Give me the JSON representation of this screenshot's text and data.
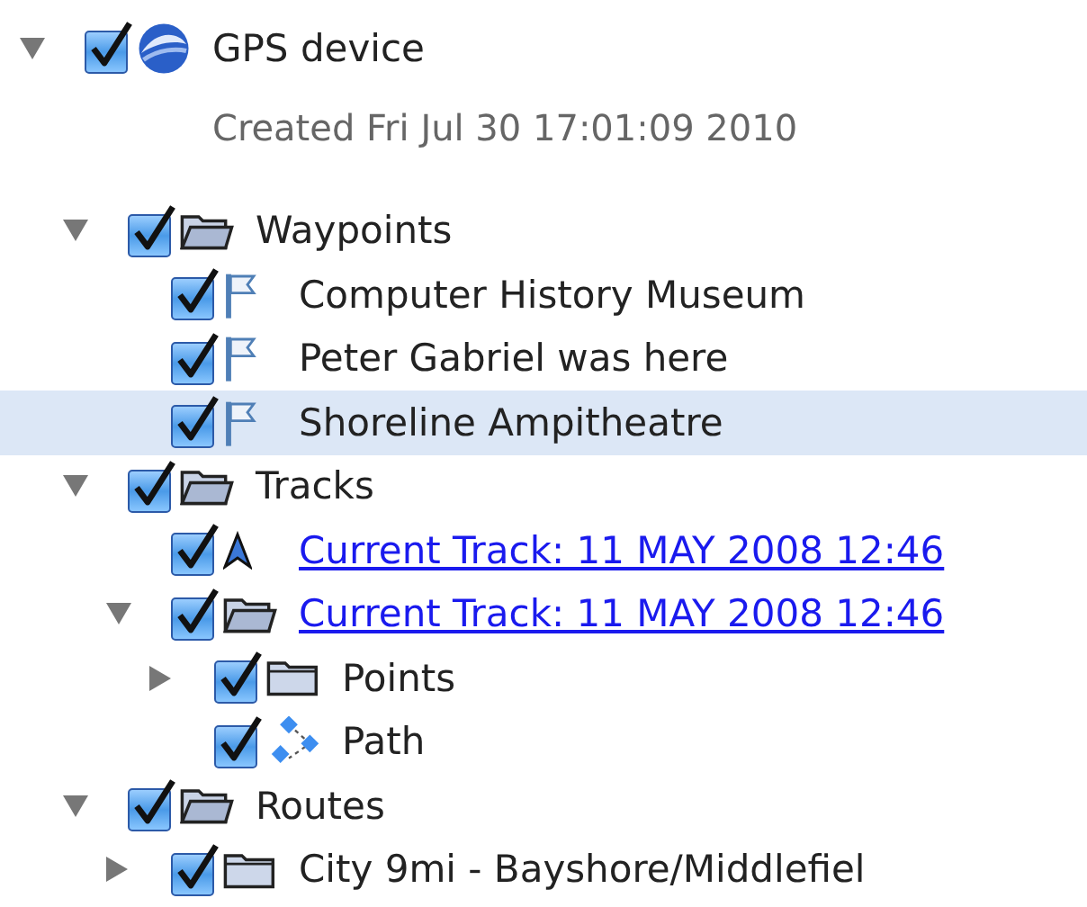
{
  "tree": [
    {
      "label": "GPS device",
      "kind": "globe",
      "checked": true,
      "expanded": true,
      "selected": false,
      "link": false,
      "description": "Created Fri Jul 30 17:01:09 2010",
      "children": [
        {
          "label": "Waypoints",
          "kind": "folder",
          "checked": true,
          "expanded": true,
          "selected": false,
          "link": false,
          "children": [
            {
              "label": "Computer History Museum",
              "kind": "flag",
              "checked": true,
              "selected": false,
              "link": false
            },
            {
              "label": "Peter Gabriel was here",
              "kind": "flag",
              "checked": true,
              "selected": false,
              "link": false
            },
            {
              "label": "Shoreline Ampitheatre",
              "kind": "flag",
              "checked": true,
              "selected": true,
              "link": false
            }
          ]
        },
        {
          "label": "Tracks",
          "kind": "folder",
          "checked": true,
          "expanded": true,
          "selected": false,
          "link": false,
          "children": [
            {
              "label": "Current Track: 11 MAY 2008 12:46",
              "kind": "track",
              "checked": true,
              "selected": false,
              "link": true
            },
            {
              "label": "Current Track: 11 MAY 2008 12:46",
              "kind": "folder",
              "checked": true,
              "expanded": true,
              "selected": false,
              "link": true,
              "children": [
                {
                  "label": "Points",
                  "kind": "folder",
                  "checked": true,
                  "expanded": false,
                  "selected": false,
                  "link": false
                },
                {
                  "label": "Path",
                  "kind": "path",
                  "checked": true,
                  "selected": false,
                  "link": false
                }
              ]
            }
          ]
        },
        {
          "label": "Routes",
          "kind": "folder",
          "checked": true,
          "expanded": true,
          "selected": false,
          "link": false,
          "children": [
            {
              "label": "City 9mi - Bayshore/Middlefiel",
              "kind": "folder",
              "checked": true,
              "expanded": false,
              "selected": false,
              "link": false
            }
          ]
        }
      ]
    }
  ]
}
